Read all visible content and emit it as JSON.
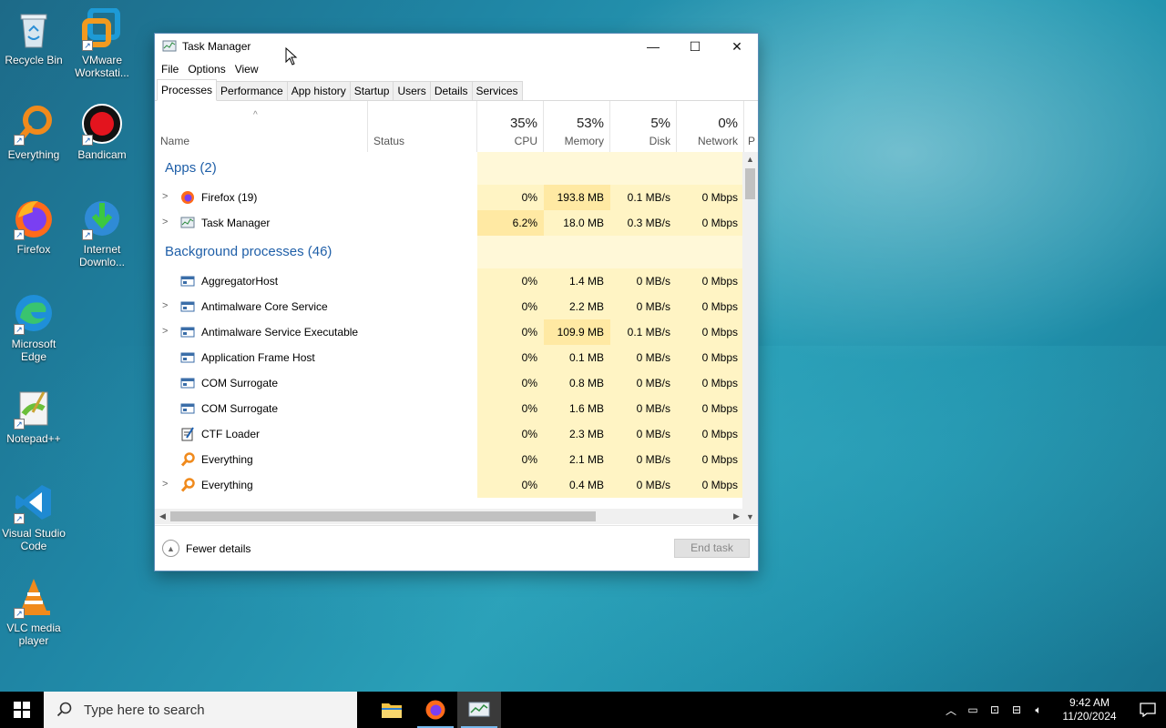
{
  "desktop": {
    "icons": [
      {
        "label": "Recycle Bin"
      },
      {
        "label": "VMware Workstati..."
      },
      {
        "label": "Everything"
      },
      {
        "label": "Bandicam"
      },
      {
        "label": "Firefox"
      },
      {
        "label": "Internet Downlo..."
      },
      {
        "label": "Microsoft Edge"
      },
      {
        "label": "Notepad++"
      },
      {
        "label": "Visual Studio Code"
      },
      {
        "label": "VLC media player"
      }
    ]
  },
  "window": {
    "title": "Task Manager",
    "controls": {
      "minimize": "—",
      "maximize": "☐",
      "close": "✕"
    },
    "menu": [
      "File",
      "Options",
      "View"
    ],
    "tabs": [
      "Processes",
      "Performance",
      "App history",
      "Startup",
      "Users",
      "Details",
      "Services"
    ],
    "columns": {
      "name": "Name",
      "status": "Status",
      "cpu": {
        "pct": "35%",
        "label": "CPU"
      },
      "memory": {
        "pct": "53%",
        "label": "Memory"
      },
      "disk": {
        "pct": "5%",
        "label": "Disk"
      },
      "network": {
        "pct": "0%",
        "label": "Network"
      },
      "power": "P"
    },
    "groups": {
      "apps": "Apps (2)",
      "background": "Background processes (46)"
    },
    "apps": [
      {
        "name": "Firefox (19)",
        "cpu": "0%",
        "mem": "193.8 MB",
        "disk": "0.1 MB/s",
        "net": "0 Mbps",
        "icon": "firefox-icon"
      },
      {
        "name": "Task Manager",
        "cpu": "6.2%",
        "mem": "18.0 MB",
        "disk": "0.3 MB/s",
        "net": "0 Mbps",
        "icon": "task-manager-icon"
      }
    ],
    "background": [
      {
        "name": "AggregatorHost",
        "cpu": "0%",
        "mem": "1.4 MB",
        "disk": "0 MB/s",
        "net": "0 Mbps",
        "expand": false
      },
      {
        "name": "Antimalware Core Service",
        "cpu": "0%",
        "mem": "2.2 MB",
        "disk": "0 MB/s",
        "net": "0 Mbps",
        "expand": true
      },
      {
        "name": "Antimalware Service Executable",
        "cpu": "0%",
        "mem": "109.9 MB",
        "disk": "0.1 MB/s",
        "net": "0 Mbps",
        "expand": true
      },
      {
        "name": "Application Frame Host",
        "cpu": "0%",
        "mem": "0.1 MB",
        "disk": "0 MB/s",
        "net": "0 Mbps",
        "expand": false
      },
      {
        "name": "COM Surrogate",
        "cpu": "0%",
        "mem": "0.8 MB",
        "disk": "0 MB/s",
        "net": "0 Mbps",
        "expand": false
      },
      {
        "name": "COM Surrogate",
        "cpu": "0%",
        "mem": "1.6 MB",
        "disk": "0 MB/s",
        "net": "0 Mbps",
        "expand": false
      },
      {
        "name": "CTF Loader",
        "cpu": "0%",
        "mem": "2.3 MB",
        "disk": "0 MB/s",
        "net": "0 Mbps",
        "expand": false
      },
      {
        "name": "Everything",
        "cpu": "0%",
        "mem": "2.1 MB",
        "disk": "0 MB/s",
        "net": "0 Mbps",
        "expand": false
      },
      {
        "name": "Everything",
        "cpu": "0%",
        "mem": "0.4 MB",
        "disk": "0 MB/s",
        "net": "0 Mbps",
        "expand": true
      }
    ],
    "footer": {
      "fewer_details": "Fewer details",
      "end_task": "End task"
    }
  },
  "taskbar": {
    "search_placeholder": "Type here to search",
    "time": "9:42 AM",
    "date": "11/20/2024"
  }
}
